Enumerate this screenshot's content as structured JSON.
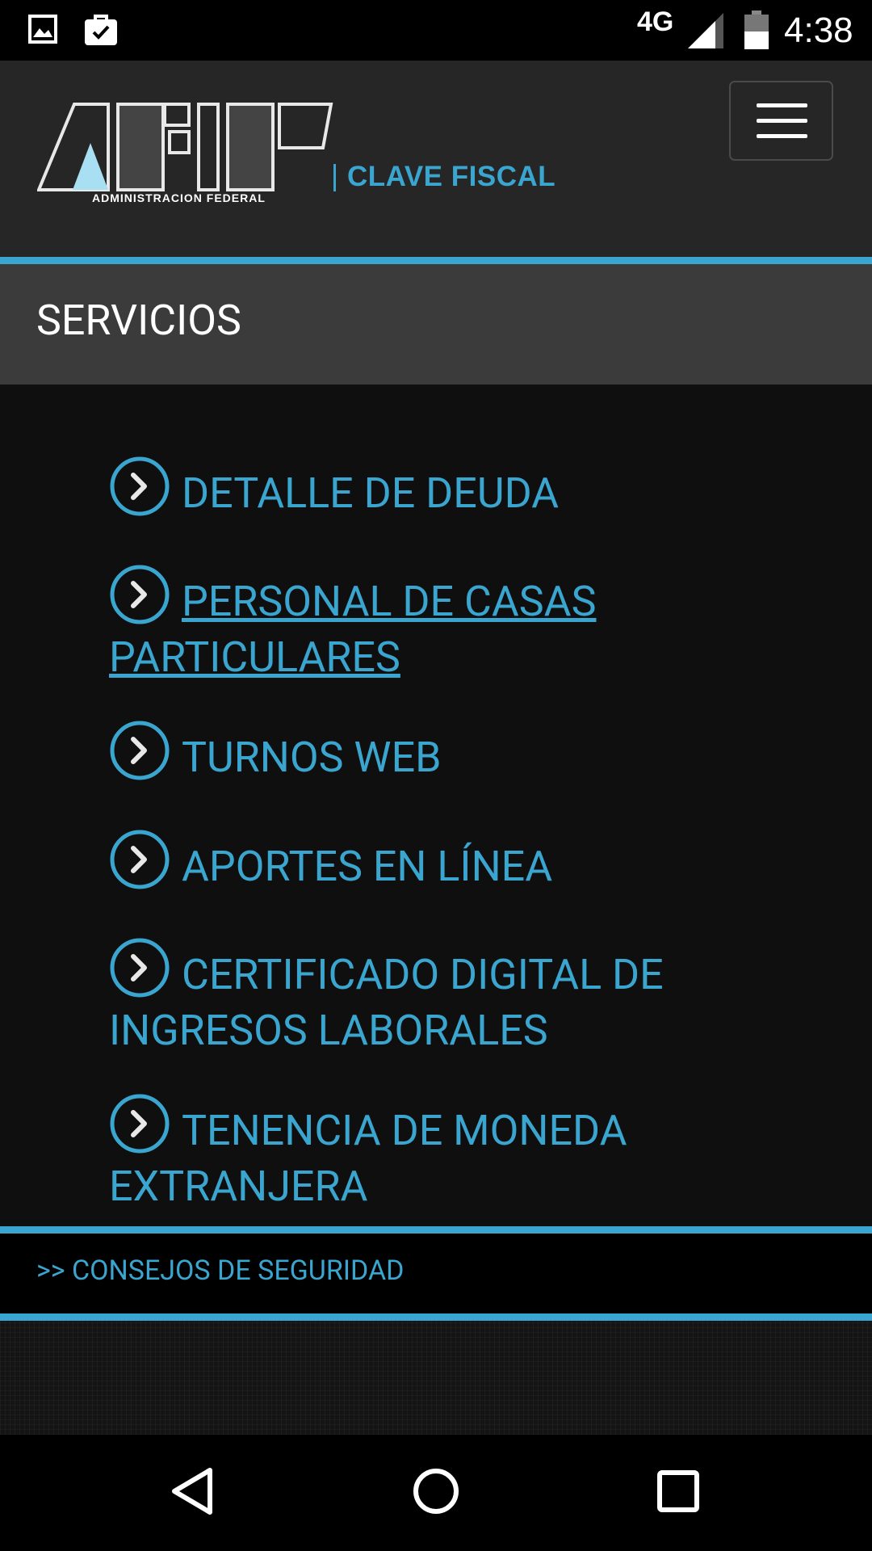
{
  "status_bar": {
    "network": "4G",
    "time": "4:38",
    "left_icons": [
      "gallery-icon",
      "work-briefcase-icon"
    ],
    "right_icons": [
      "signal-icon",
      "battery-icon"
    ]
  },
  "header": {
    "logo_text": "AFIP",
    "logo_subtitle": "ADMINISTRACION FEDERAL",
    "product_label": "CLAVE FISCAL",
    "menu_icon": "hamburger-menu-icon"
  },
  "section": {
    "title": "SERVICIOS"
  },
  "services": [
    {
      "label": "DETALLE DE DEUDA",
      "underlined": false
    },
    {
      "label": "PERSONAL DE CASAS PARTICULARES",
      "underlined": true
    },
    {
      "label": "TURNOS WEB",
      "underlined": false
    },
    {
      "label": "APORTES EN LÍNEA",
      "underlined": false
    },
    {
      "label": "CERTIFICADO DIGITAL DE INGRESOS LABORALES",
      "underlined": false
    },
    {
      "label": "TENENCIA DE MONEDA EXTRANJERA",
      "underlined": false
    }
  ],
  "footer": {
    "security_link": ">> CONSEJOS DE SEGURIDAD"
  },
  "nav_bar": {
    "buttons": [
      "back-icon",
      "home-icon",
      "recents-icon"
    ]
  },
  "colors": {
    "accent": "#3aa5cf",
    "header_bg": "#262626",
    "section_bg": "#3b3b3b",
    "content_bg": "#0f0f0f"
  }
}
